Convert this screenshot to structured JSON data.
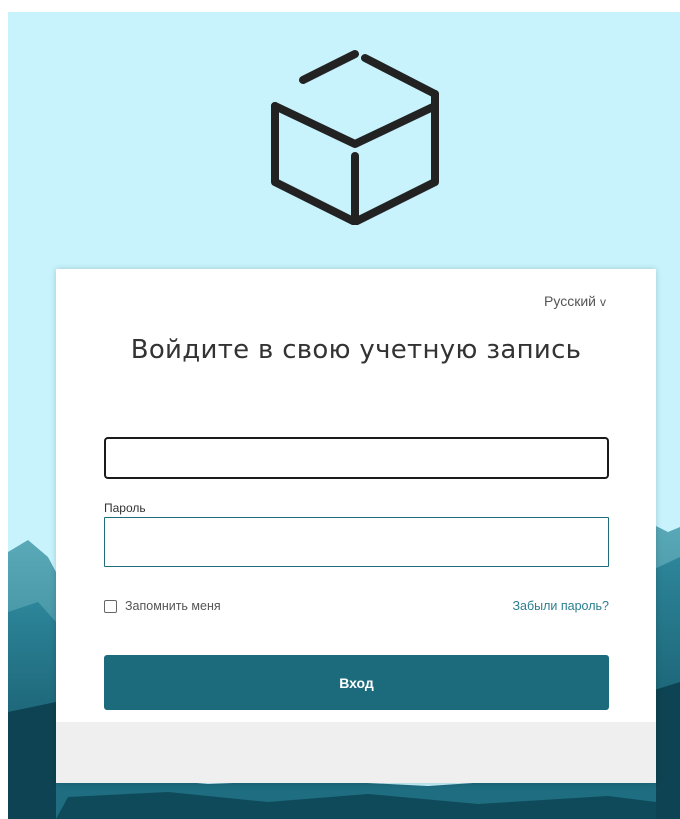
{
  "page": {
    "background_color": "#c8f3fd",
    "logo_icon": "cube-icon"
  },
  "card": {
    "language_label": "Русский",
    "language_chevron": "v",
    "title": "Войдите в свою учетную запись"
  },
  "form": {
    "username": {
      "value": "",
      "placeholder": ""
    },
    "password": {
      "label": "Пароль",
      "value": "",
      "placeholder": ""
    },
    "remember_label": "Запомнить меня",
    "remember_checked": false,
    "forgot_label": "Забыли пароль?",
    "submit_label": "Вход"
  },
  "colors": {
    "accent": "#1c6b7c",
    "link": "#2a7f8f",
    "input_focus_border": "#1a1a1a",
    "input_border": "#1f6d7a"
  }
}
